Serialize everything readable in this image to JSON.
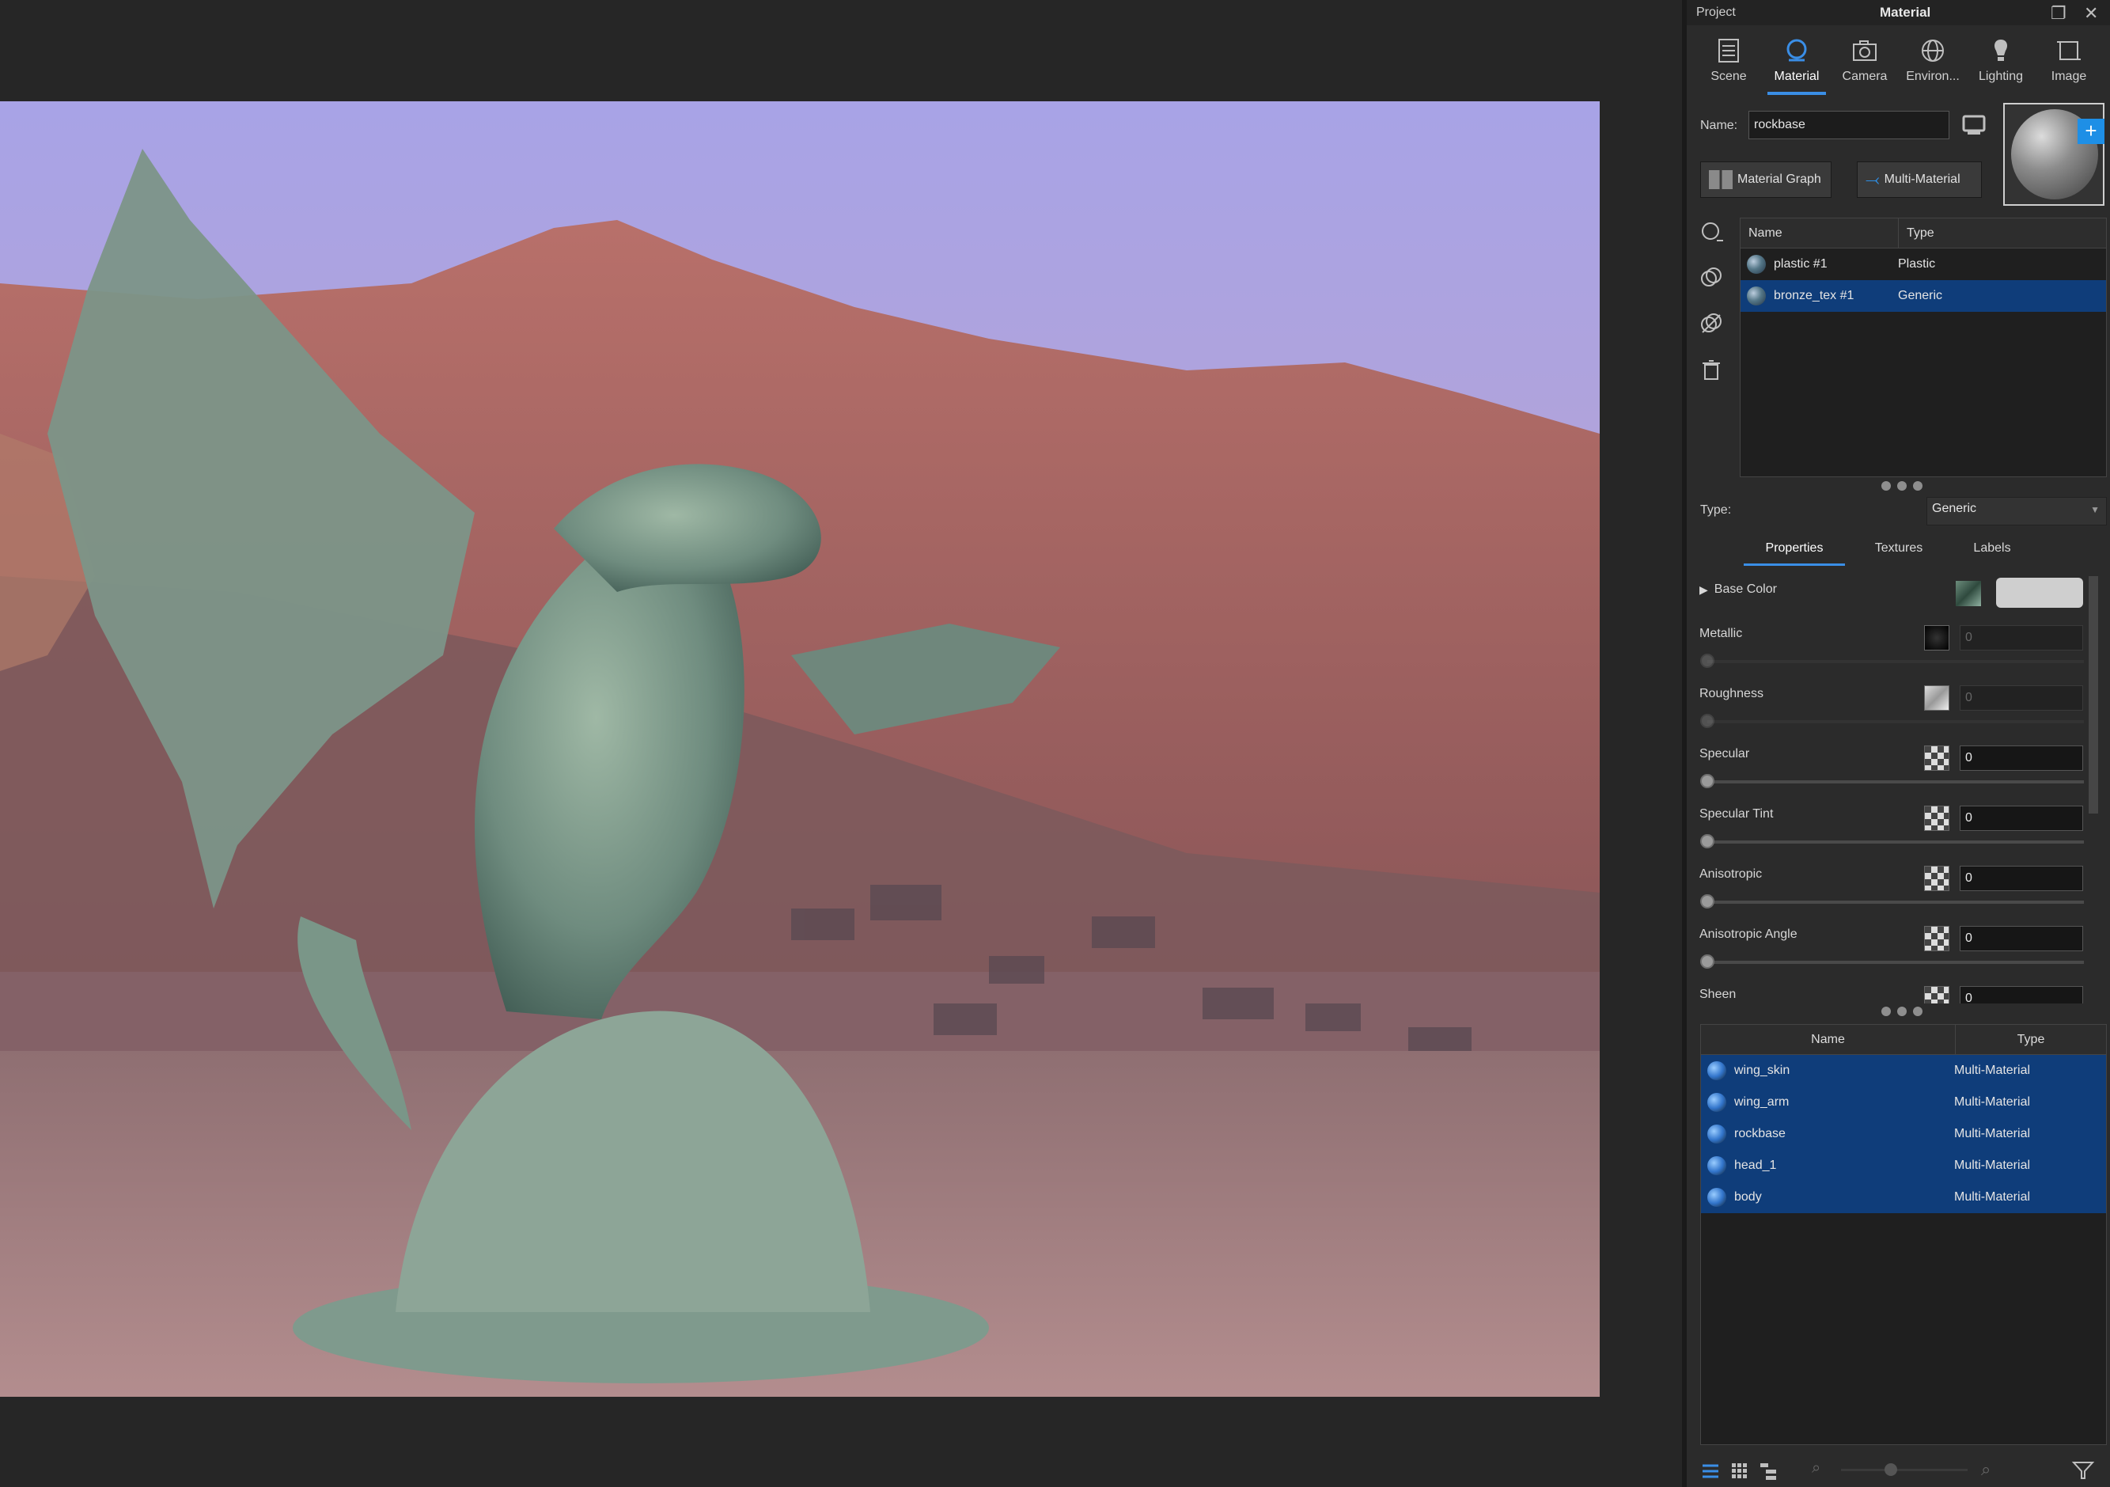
{
  "panel": {
    "project_label": "Project",
    "title": "Material",
    "tabs": [
      {
        "label": "Scene",
        "icon": "scene-icon"
      },
      {
        "label": "Material",
        "icon": "material-icon"
      },
      {
        "label": "Camera",
        "icon": "camera-icon"
      },
      {
        "label": "Environ...",
        "icon": "globe-icon"
      },
      {
        "label": "Lighting",
        "icon": "bulb-icon"
      },
      {
        "label": "Image",
        "icon": "image-crop-icon"
      }
    ],
    "active_tab": "Material",
    "name_label": "Name:",
    "name_value": "rockbase",
    "material_graph_label": "Material Graph",
    "multi_material_label": "Multi-Material",
    "materials_table": {
      "columns": [
        "Name",
        "Type"
      ],
      "rows": [
        {
          "name": "plastic #1",
          "type": "Plastic",
          "selected": false
        },
        {
          "name": "bronze_tex #1",
          "type": "Generic",
          "selected": true
        }
      ]
    },
    "type_label": "Type:",
    "type_value": "Generic",
    "prop_tabs": [
      "Properties",
      "Textures",
      "Labels"
    ],
    "active_prop_tab": "Properties",
    "base_color_label": "Base Color",
    "properties": [
      {
        "label": "Metallic",
        "value": "0",
        "enabled": false
      },
      {
        "label": "Roughness",
        "value": "0",
        "enabled": false
      },
      {
        "label": "Specular",
        "value": "0",
        "enabled": true
      },
      {
        "label": "Specular Tint",
        "value": "0",
        "enabled": true
      },
      {
        "label": "Anisotropic",
        "value": "0",
        "enabled": true
      },
      {
        "label": "Anisotropic Angle",
        "value": "0",
        "enabled": true
      },
      {
        "label": "Sheen",
        "value": "0",
        "enabled": true
      }
    ],
    "library_table": {
      "columns": [
        "Name",
        "Type"
      ],
      "rows": [
        {
          "name": "wing_skin",
          "type": "Multi-Material"
        },
        {
          "name": "wing_arm",
          "type": "Multi-Material"
        },
        {
          "name": "rockbase",
          "type": "Multi-Material"
        },
        {
          "name": "head_1",
          "type": "Multi-Material"
        },
        {
          "name": "body",
          "type": "Multi-Material"
        }
      ]
    },
    "colors": {
      "accent": "#3a8ee6",
      "selection": "#0f3d7a",
      "panel_bg": "#2b2b2b"
    }
  }
}
